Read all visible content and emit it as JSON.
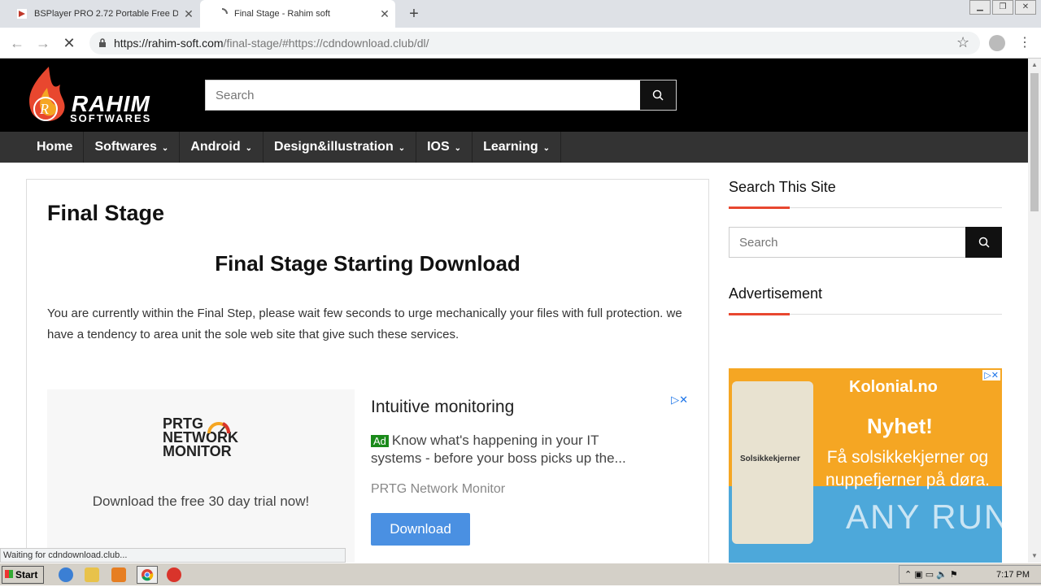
{
  "browser": {
    "tabs": [
      {
        "title": "BSPlayer PRO 2.72 Portable Free Do",
        "active": false
      },
      {
        "title": "Final Stage - Rahim soft",
        "active": true
      }
    ],
    "new_tab": "+",
    "url_host": "https://rahim-soft.com",
    "url_path": "/final-stage/#https://cdndownload.club/dl/",
    "status": "Waiting for cdndownload.club..."
  },
  "header": {
    "brand": "RAHIM",
    "brand_sub": "SOFTWARES",
    "search_placeholder": "Search"
  },
  "menu": [
    {
      "label": "Home",
      "dropdown": false
    },
    {
      "label": "Softwares",
      "dropdown": true
    },
    {
      "label": "Android",
      "dropdown": true
    },
    {
      "label": "Design&illustration",
      "dropdown": true
    },
    {
      "label": "IOS",
      "dropdown": true
    },
    {
      "label": "Learning",
      "dropdown": true
    }
  ],
  "article": {
    "title": "Final Stage",
    "heading": "Final Stage Starting Download",
    "body": "You are currently within the Final Step, please wait few seconds to urge mechanically your files with full protection. we have a tendency to area unit the sole web site that give such these services."
  },
  "ad": {
    "logo_line1": "PRTG",
    "logo_line2": "NETWORK",
    "logo_line3": "MONITOR",
    "cta": "Download the free 30 day trial now!",
    "headline": "Intuitive monitoring",
    "badge": "Ad",
    "text": "Know what's happening in your IT systems - before your boss picks up the...",
    "advertiser": "PRTG Network Monitor",
    "button": "Download"
  },
  "sidebar": {
    "search_title": "Search This Site",
    "search_placeholder": "Search",
    "ad_title": "Advertisement",
    "ad_brand": "Kolonial.no",
    "ad_headline": "Nyhet!",
    "ad_text": "Få solsikkekjerner og nuppefjerner på døra.",
    "ad_pkg_label": "Solsikkekjerner"
  },
  "watermark": "ANY RUN",
  "taskbar": {
    "start": "Start",
    "clock": "7:17 PM"
  }
}
